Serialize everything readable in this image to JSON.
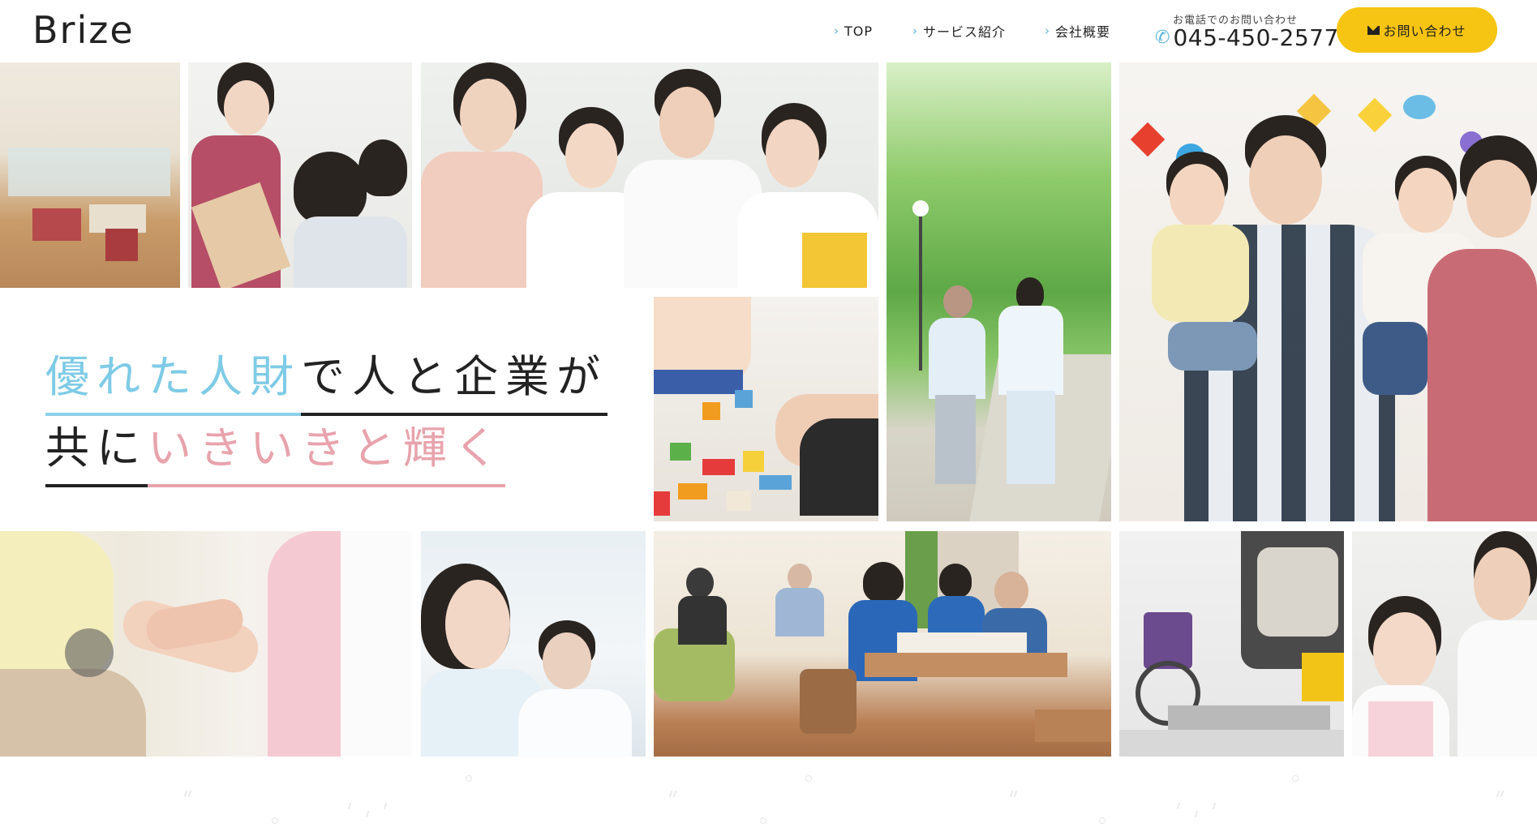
{
  "header": {
    "logo": "Brize",
    "nav": [
      {
        "label": "TOP"
      },
      {
        "label": "サービス紹介"
      },
      {
        "label": "会社概要"
      }
    ],
    "phone_label": "お電話でのお問い合わせ",
    "phone_number": "045-450-2577",
    "cta_label": "お問い合わせ"
  },
  "hero": {
    "line1_blue": "優れた人財",
    "line1_dark": "で人と企業が",
    "line2_dark": "共に",
    "line2_pink": "いきいきと輝く"
  },
  "colors": {
    "accent_yellow": "#f6c412",
    "accent_blue": "#8ed0ea",
    "accent_pink": "#e8a3ad"
  },
  "icons": [
    "chevron-right-icon",
    "phone-icon",
    "mail-icon"
  ]
}
